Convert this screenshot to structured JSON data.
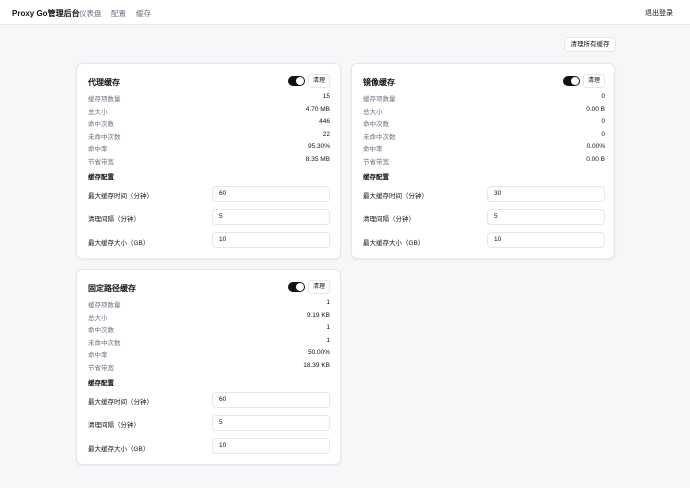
{
  "header": {
    "brand": "Proxy Go管理后台",
    "nav": [
      "仪表盘",
      "配置",
      "缓存"
    ],
    "logout": "退出登录"
  },
  "toolbar": {
    "clear_all": "清理所有缓存"
  },
  "colors": {
    "toggle_on": "#111111",
    "muted_text": "#6b7280",
    "border": "#e5e7eb"
  },
  "cards": [
    {
      "title": "代理缓存",
      "enabled": true,
      "clear_label": "清理",
      "stats": [
        {
          "label": "缓存项数量",
          "value": "15"
        },
        {
          "label": "总大小",
          "value": "4.70 MB"
        },
        {
          "label": "命中次数",
          "value": "446"
        },
        {
          "label": "未命中次数",
          "value": "22"
        },
        {
          "label": "命中率",
          "value": "95.30%"
        },
        {
          "label": "节省带宽",
          "value": "8.35 MB"
        }
      ],
      "config_title": "缓存配置",
      "config": [
        {
          "label": "最大缓存时间（分钟）",
          "value": "60"
        },
        {
          "label": "清理间隔（分钟）",
          "value": "5"
        },
        {
          "label": "最大缓存大小（GB）",
          "value": "10"
        }
      ]
    },
    {
      "title": "镜像缓存",
      "enabled": true,
      "clear_label": "清理",
      "stats": [
        {
          "label": "缓存项数量",
          "value": "0"
        },
        {
          "label": "总大小",
          "value": "0.00 B"
        },
        {
          "label": "命中次数",
          "value": "0"
        },
        {
          "label": "未命中次数",
          "value": "0"
        },
        {
          "label": "命中率",
          "value": "0.00%"
        },
        {
          "label": "节省带宽",
          "value": "0.00 B"
        }
      ],
      "config_title": "缓存配置",
      "config": [
        {
          "label": "最大缓存时间（分钟）",
          "value": "30"
        },
        {
          "label": "清理间隔（分钟）",
          "value": "5"
        },
        {
          "label": "最大缓存大小（GB）",
          "value": "10"
        }
      ]
    },
    {
      "title": "固定路径缓存",
      "enabled": true,
      "clear_label": "清理",
      "stats": [
        {
          "label": "缓存项数量",
          "value": "1"
        },
        {
          "label": "总大小",
          "value": "9.19 KB"
        },
        {
          "label": "命中次数",
          "value": "1"
        },
        {
          "label": "未命中次数",
          "value": "1"
        },
        {
          "label": "命中率",
          "value": "50.00%"
        },
        {
          "label": "节省带宽",
          "value": "18.39 KB"
        }
      ],
      "config_title": "缓存配置",
      "config": [
        {
          "label": "最大缓存时间（分钟）",
          "value": "60"
        },
        {
          "label": "清理间隔（分钟）",
          "value": "5"
        },
        {
          "label": "最大缓存大小（GB）",
          "value": "10"
        }
      ]
    }
  ]
}
